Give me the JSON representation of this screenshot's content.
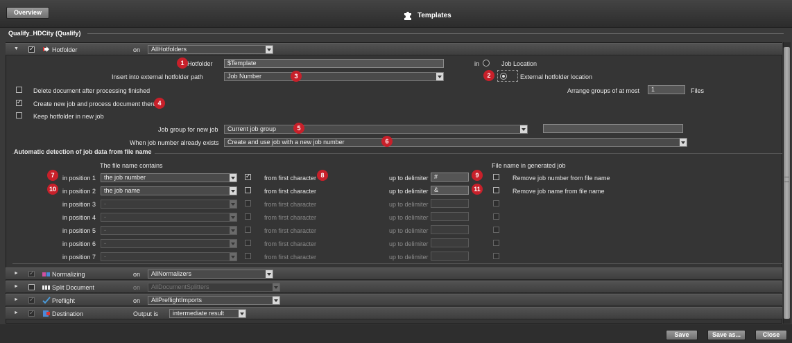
{
  "header": {
    "overview_label": "Overview",
    "title": "Templates"
  },
  "group": {
    "title": "Qualify_HDCity (Qualify)"
  },
  "hotfolder_section": {
    "name": "Hotfolder",
    "on_label": "on",
    "on_value": "AllHotfolders",
    "hotfolder_label": "Hotfolder",
    "hotfolder_value": "$Template",
    "in_label": "in",
    "job_location_label": "Job Location",
    "insert_path_label": "Insert into external hotfolder path",
    "insert_path_value": "Job Number",
    "external_location_label": "External hotfolder location",
    "delete_doc_label": "Delete document after processing finished",
    "arrange_label": "Arrange groups of at most",
    "arrange_value": "1",
    "files_label": "Files",
    "create_job_label": "Create new job and process document there",
    "keep_hotfolder_label": "Keep hotfolder in new job",
    "job_group_label": "Job group for new job",
    "job_group_value": "Current job group",
    "job_group_extra": "",
    "exists_label": "When job number already exists",
    "exists_value": "Create and use job with a new job number"
  },
  "auto_detect": {
    "title": "Automatic detection of job data from file name",
    "contains_header": "The file name contains",
    "generated_header": "File name in generated job",
    "rows": [
      {
        "pos": "in position 1",
        "value": "the job number",
        "from": "from first character",
        "up": "up to delimiter",
        "delim": "#",
        "remove": "Remove job number from file name"
      },
      {
        "pos": "in position 2",
        "value": "the job name",
        "from": "from first character",
        "up": "up to delimiter",
        "delim": "&",
        "remove": "Remove job name from file name"
      },
      {
        "pos": "in position 3",
        "value": "-",
        "from": "from first character",
        "up": "up to delimiter",
        "delim": ""
      },
      {
        "pos": "in position 4",
        "value": "-",
        "from": "from first character",
        "up": "up to delimiter",
        "delim": ""
      },
      {
        "pos": "in position 5",
        "value": "-",
        "from": "from first character",
        "up": "up to delimiter",
        "delim": ""
      },
      {
        "pos": "in position 6",
        "value": "-",
        "from": "from first character",
        "up": "up to delimiter",
        "delim": ""
      },
      {
        "pos": "in position 7",
        "value": "-",
        "from": "from first character",
        "up": "up to delimiter",
        "delim": ""
      }
    ]
  },
  "badges": [
    "1",
    "2",
    "3",
    "4",
    "5",
    "6",
    "7",
    "8",
    "9",
    "10",
    "11"
  ],
  "sections": [
    {
      "name": "Normalizing",
      "on_label": "on",
      "value": "AllNormalizers"
    },
    {
      "name": "Split Document",
      "on_label": "on",
      "value": "AllDocumentSplitters"
    },
    {
      "name": "Preflight",
      "on_label": "on",
      "value": "AllPreflightImports"
    },
    {
      "name": "Destination",
      "on_label": "Output is",
      "value": "intermediate result"
    }
  ],
  "footer": {
    "save": "Save",
    "save_as": "Save as...",
    "close": "Close"
  },
  "colors": {
    "badge": "#c8202a",
    "background": "#3a3a3a"
  }
}
